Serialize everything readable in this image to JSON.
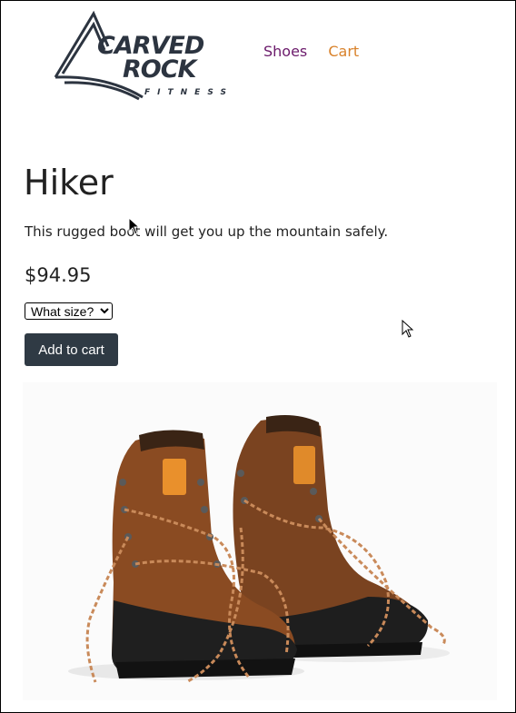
{
  "brand": {
    "name": "Carved Rock Fitness",
    "logo_icon": "carved-rock-mountain-logo",
    "colors": {
      "logo": "#2c3440"
    }
  },
  "nav": {
    "shoes_label": "Shoes",
    "cart_label": "Cart",
    "colors": {
      "shoes": "#6b1a6b",
      "cart": "#d9822b"
    }
  },
  "product": {
    "name": "Hiker",
    "description": "This rugged boot will get you up the mountain safely.",
    "price": "$94.95",
    "size_select": {
      "selected": "What size?"
    },
    "add_button_label": "Add to cart",
    "image_icon": "hiking-boots-image"
  }
}
